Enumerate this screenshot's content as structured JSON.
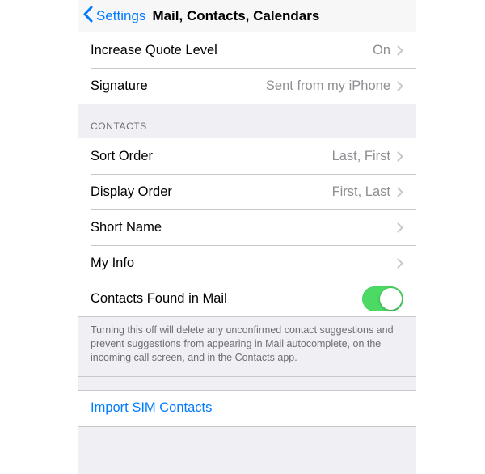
{
  "colors": {
    "accent": "#007aff",
    "toggle_on": "#4cd964"
  },
  "nav": {
    "back_label": "Settings",
    "title": "Mail, Contacts, Calendars"
  },
  "mail_group": {
    "rows": {
      "increase_quote": {
        "label": "Increase Quote Level",
        "value": "On"
      },
      "signature": {
        "label": "Signature",
        "value": "Sent from my iPhone"
      }
    }
  },
  "contacts_group": {
    "header": "CONTACTS",
    "rows": {
      "sort_order": {
        "label": "Sort Order",
        "value": "Last, First"
      },
      "display_order": {
        "label": "Display Order",
        "value": "First, Last"
      },
      "short_name": {
        "label": "Short Name"
      },
      "my_info": {
        "label": "My Info"
      },
      "contacts_in_mail": {
        "label": "Contacts Found in Mail",
        "toggle": true
      }
    },
    "footer": "Turning this off will delete any unconfirmed contact suggestions and prevent suggestions from appearing in Mail autocomplete, on the incoming call screen, and in the Contacts app."
  },
  "import_group": {
    "action_label": "Import SIM Contacts"
  }
}
